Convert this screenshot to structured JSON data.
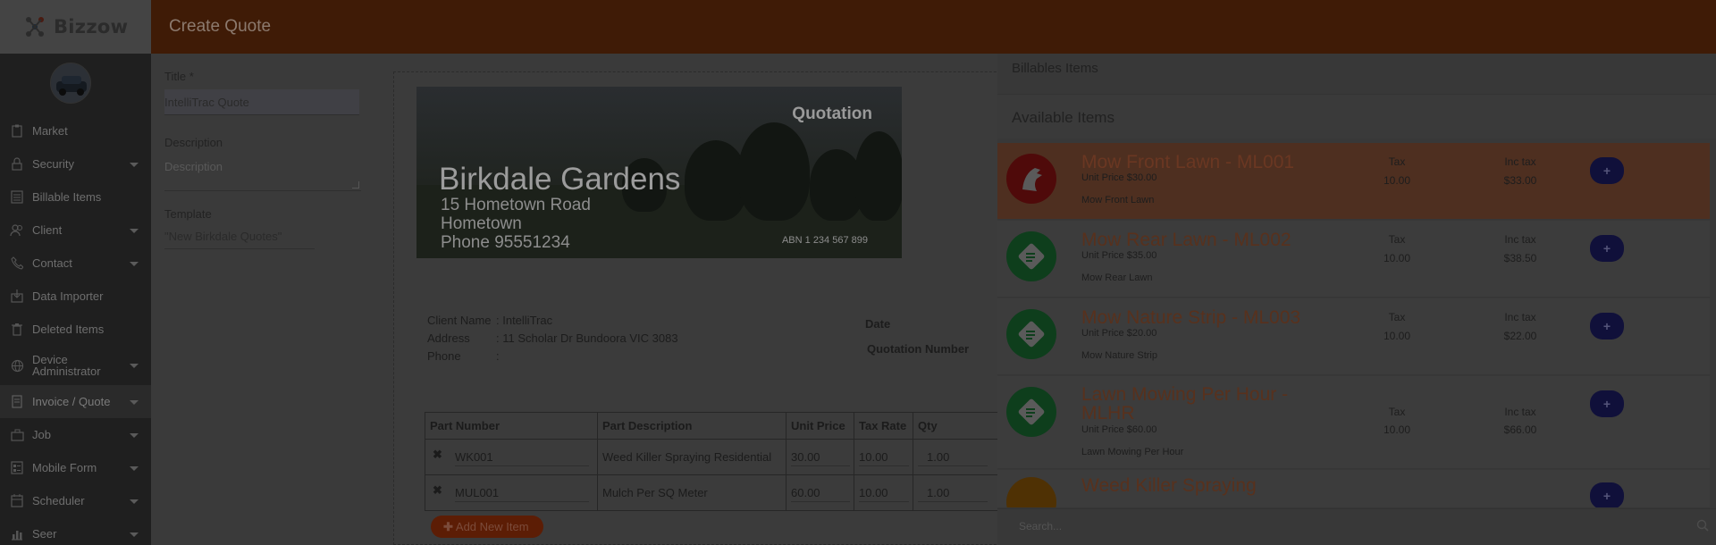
{
  "app": {
    "logo_text": "Bizzow"
  },
  "header": {
    "title": "Create Quote"
  },
  "sidebar": {
    "items": [
      {
        "label": "Market",
        "icon": "clipboard-icon",
        "caret": false
      },
      {
        "label": "Security",
        "icon": "lock-icon",
        "caret": true
      },
      {
        "label": "Billable Items",
        "icon": "list-icon",
        "caret": false
      },
      {
        "label": "Client",
        "icon": "users-icon",
        "caret": true
      },
      {
        "label": "Contact",
        "icon": "phone-icon",
        "caret": true
      },
      {
        "label": "Data Importer",
        "icon": "import-icon",
        "caret": false
      },
      {
        "label": "Deleted Items",
        "icon": "trash-icon",
        "caret": false
      },
      {
        "label": "Device Administrator",
        "icon": "globe-icon",
        "caret": true
      },
      {
        "label": "Invoice / Quote",
        "icon": "invoice-icon",
        "caret": true
      },
      {
        "label": "Job",
        "icon": "briefcase-icon",
        "caret": true
      },
      {
        "label": "Mobile Form",
        "icon": "form-icon",
        "caret": true
      },
      {
        "label": "Scheduler",
        "icon": "calendar-icon",
        "caret": true
      },
      {
        "label": "Seer",
        "icon": "chart-icon",
        "caret": true
      }
    ]
  },
  "form": {
    "title_label": "Title *",
    "title_value": "IntelliTrac Quote",
    "description_label": "Description",
    "description_placeholder": "Description",
    "template_label": "Template",
    "template_value": "\"New Birkdale Quotes\""
  },
  "preview": {
    "banner": {
      "heading": "Quotation",
      "company": "Birkdale Gardens",
      "address1": "15 Hometown Road",
      "address2": "Hometown",
      "phone": "Phone 95551234",
      "abn": "ABN 1 234 567 899"
    },
    "client_name_label": "Client Name",
    "client_name_value": ": IntelliTrac",
    "address_label": "Address",
    "address_value": ": 11 Scholar Dr Bundoora VIC 3083",
    "phone_label": "Phone",
    "phone_value": ":",
    "date_label": "Date",
    "quotation_number_label": "Quotation Number",
    "table": {
      "headers": [
        "Part Number",
        "Part Description",
        "Unit Price",
        "Tax Rate",
        "Qty"
      ],
      "rows": [
        {
          "part_number": "WK001",
          "description": "Weed Killer Spraying Residential",
          "unit_price": "30.00",
          "tax_rate": "10.00",
          "qty": "1.00"
        },
        {
          "part_number": "MUL001",
          "description": "Mulch Per SQ Meter",
          "unit_price": "60.00",
          "tax_rate": "10.00",
          "qty": "1.00"
        }
      ]
    },
    "add_item_label": "Add New Item"
  },
  "billables": {
    "heading": "Billables Items",
    "available_heading": "Available Items",
    "items": [
      {
        "name": "Mow Front Lawn - ML001",
        "unit_price": "Unit Price $30.00",
        "description": "Mow Front Lawn",
        "tax_label": "Tax",
        "tax_value": "10.00",
        "inc_label": "Inc tax",
        "inc_value": "$33.00",
        "icon": "app-logo-icon",
        "color": "#4f0a0a"
      },
      {
        "name": "Mow Rear Lawn - ML002",
        "unit_price": "Unit Price $35.00",
        "description": "Mow Rear Lawn",
        "tax_label": "Tax",
        "tax_value": "10.00",
        "inc_label": "Inc tax",
        "inc_value": "$38.50",
        "icon": "item-icon",
        "color": "#0e3e1c"
      },
      {
        "name": "Mow Nature Strip - ML003",
        "unit_price": "Unit Price $20.00",
        "description": "Mow Nature Strip",
        "tax_label": "Tax",
        "tax_value": "10.00",
        "inc_label": "Inc tax",
        "inc_value": "$22.00",
        "icon": "item-icon",
        "color": "#0e3e1c"
      },
      {
        "name": "Lawn Mowing Per Hour - MLHR",
        "unit_price": "Unit Price $60.00",
        "description": "Lawn Mowing Per Hour",
        "tax_label": "Tax",
        "tax_value": "10.00",
        "inc_label": "Inc tax",
        "inc_value": "$66.00",
        "icon": "item-icon",
        "color": "#0e3e1c"
      },
      {
        "name": "Weed Killer Spraying",
        "icon": "item-icon",
        "color": "#4f3104"
      }
    ],
    "add_symbol": "+",
    "search_placeholder": "Search..."
  },
  "colors": {
    "header_bg": "#3f1b06",
    "accent": "#5c1d05",
    "highlight": "#4e2f20"
  }
}
